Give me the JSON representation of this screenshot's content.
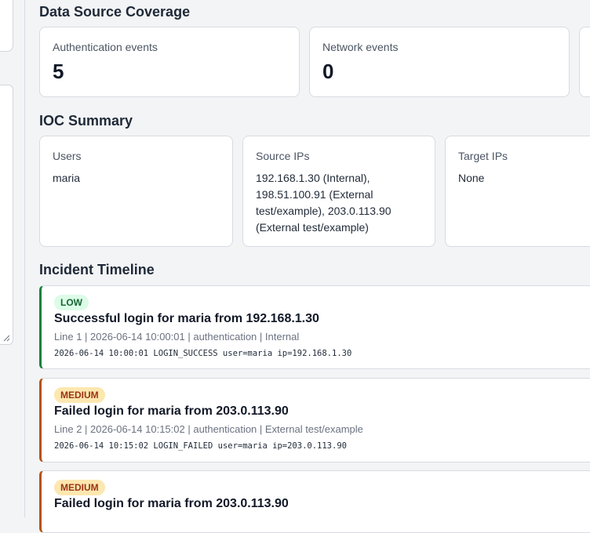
{
  "coverage": {
    "heading": "Data Source Coverage",
    "cards": [
      {
        "label": "Authentication events",
        "value": "5"
      },
      {
        "label": "Network events",
        "value": "0"
      }
    ]
  },
  "ioc": {
    "heading": "IOC Summary",
    "cards": [
      {
        "label": "Users",
        "value": "maria"
      },
      {
        "label": "Source IPs",
        "value": "192.168.1.30 (Internal), 198.51.100.91 (External test/example), 203.0.113.90 (External test/example)"
      },
      {
        "label": "Target IPs",
        "value": "None"
      }
    ]
  },
  "timeline": {
    "heading": "Incident Timeline",
    "events": [
      {
        "severity": "LOW",
        "title": "Successful login for maria from 192.168.1.30",
        "meta": "Line 1 | 2026-06-14 10:00:01 | authentication | Internal",
        "raw": "2026-06-14 10:00:01 LOGIN_SUCCESS user=maria ip=192.168.1.30"
      },
      {
        "severity": "MEDIUM",
        "title": "Failed login for maria from 203.0.113.90",
        "meta": "Line 2 | 2026-06-14 10:15:02 | authentication | External test/example",
        "raw": "2026-06-14 10:15:02 LOGIN_FAILED user=maria ip=203.0.113.90"
      },
      {
        "severity": "MEDIUM",
        "title": "Failed login for maria from 203.0.113.90"
      }
    ]
  },
  "colors": {
    "low_accent": "#15803d",
    "medium_accent": "#b45309",
    "low_badge_bg": "#dcfce7",
    "medium_badge_bg": "#fde7b0"
  }
}
